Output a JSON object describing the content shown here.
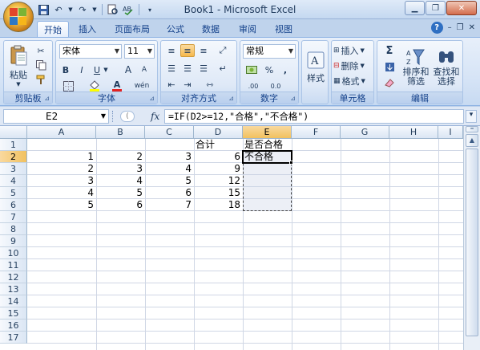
{
  "window": {
    "title": "Book1 - Microsoft Excel",
    "controls": [
      "minimize",
      "restore",
      "close"
    ]
  },
  "quick_access": [
    "save-icon",
    "undo-icon",
    "redo-icon",
    "print-preview-icon",
    "customize-icon"
  ],
  "tabs": [
    {
      "label": "开始",
      "active": true
    },
    {
      "label": "插入",
      "active": false
    },
    {
      "label": "页面布局",
      "active": false
    },
    {
      "label": "公式",
      "active": false
    },
    {
      "label": "数据",
      "active": false
    },
    {
      "label": "审阅",
      "active": false
    },
    {
      "label": "视图",
      "active": false
    }
  ],
  "ribbon": {
    "clipboard": {
      "label": "剪贴板",
      "paste": "粘贴"
    },
    "font": {
      "label": "字体",
      "name": "宋体",
      "size": "11",
      "bold": "B",
      "italic": "I",
      "underline": "U",
      "grow": "A",
      "shrink": "A",
      "font_color": "A",
      "wen": "wén"
    },
    "alignment": {
      "label": "对齐方式"
    },
    "number": {
      "label": "数字",
      "format": "常规",
      "percent": "%",
      "comma": ",",
      "dec_inc": ".00",
      "dec_dec": "0.0"
    },
    "styles": {
      "label": "样式"
    },
    "cells": {
      "label": "单元格",
      "insert": "插入",
      "delete": "删除",
      "format": "格式"
    },
    "editing": {
      "label": "编辑",
      "sigma": "Σ",
      "sort_filter": "排序和\n筛选",
      "sort1": "排序和",
      "sort2": "筛选",
      "find1": "查找和",
      "find2": "选择"
    }
  },
  "formula_bar": {
    "name_box": "E2",
    "fx": "fx",
    "formula": "=IF(D2>=12,\"合格\",\"不合格\")"
  },
  "grid": {
    "columns": [
      "A",
      "B",
      "C",
      "D",
      "E",
      "F",
      "G",
      "H",
      "I"
    ],
    "rows": [
      "1",
      "2",
      "3",
      "4",
      "5",
      "6",
      "7",
      "8",
      "9",
      "10",
      "11",
      "12",
      "13",
      "14",
      "15",
      "16",
      "17"
    ],
    "selected_column": "E",
    "selected_row": "2",
    "headers": {
      "D1": "合计",
      "E1": "是否合格"
    },
    "data": [
      {
        "A": "1",
        "B": "2",
        "C": "3",
        "D": "6",
        "E": "不合格"
      },
      {
        "A": "2",
        "B": "3",
        "C": "4",
        "D": "9",
        "E": ""
      },
      {
        "A": "3",
        "B": "4",
        "C": "5",
        "D": "12",
        "E": ""
      },
      {
        "A": "4",
        "B": "5",
        "C": "6",
        "D": "15",
        "E": ""
      },
      {
        "A": "5",
        "B": "6",
        "C": "7",
        "D": "18",
        "E": ""
      }
    ]
  },
  "colors": {
    "accent": "#15428b",
    "selection_header": "#f1c15f"
  }
}
